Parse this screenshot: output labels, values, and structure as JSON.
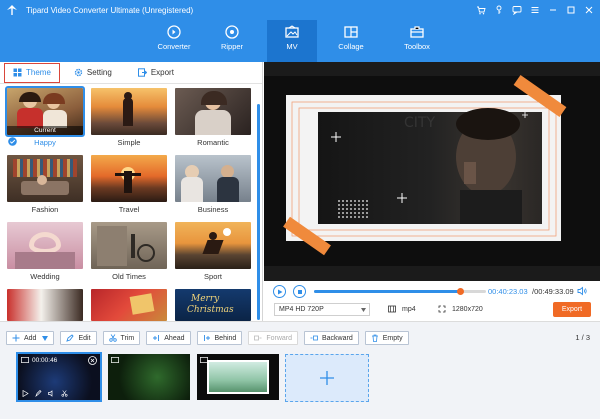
{
  "app": {
    "title": "Tipard Video Converter Ultimate (Unregistered)"
  },
  "nav": [
    {
      "label": "Converter",
      "icon": "converter-icon"
    },
    {
      "label": "Ripper",
      "icon": "ripper-icon"
    },
    {
      "label": "MV",
      "icon": "mv-icon",
      "active": true
    },
    {
      "label": "Collage",
      "icon": "collage-icon"
    },
    {
      "label": "Toolbox",
      "icon": "toolbox-icon"
    }
  ],
  "subtabs": {
    "theme": "Theme",
    "setting": "Setting",
    "export": "Export"
  },
  "themes": [
    {
      "label": "Happy",
      "selected": true,
      "current_tag": "Current"
    },
    {
      "label": "Simple"
    },
    {
      "label": "Romantic"
    },
    {
      "label": "Fashion"
    },
    {
      "label": "Travel"
    },
    {
      "label": "Business"
    },
    {
      "label": "Wedding"
    },
    {
      "label": "Old Times"
    },
    {
      "label": "Sport"
    },
    {
      "label": ""
    },
    {
      "label": ""
    },
    {
      "label": "",
      "thumb_text_1": "Merry",
      "thumb_text_2": "Christmas"
    }
  ],
  "player": {
    "current_time": "00:40:23.03",
    "total_time": "/00:49:33.09",
    "progress": 0.85
  },
  "format": {
    "selected": "MP4 HD 720P",
    "container": "mp4",
    "resolution": "1280x720"
  },
  "export_label": "Export",
  "toolbar": {
    "add": "Add",
    "edit": "Edit",
    "trim": "Trim",
    "ahead": "Ahead",
    "behind": "Behind",
    "forward": "Forward",
    "backward": "Backward",
    "empty": "Empty"
  },
  "page_count": "1 / 3",
  "clips": [
    {
      "time": "00:00:46"
    },
    {
      "time": ""
    },
    {
      "time": ""
    }
  ],
  "colors": {
    "accent": "#2f8ee8",
    "export": "#f06a25",
    "nav_active": "#1c75cf"
  }
}
